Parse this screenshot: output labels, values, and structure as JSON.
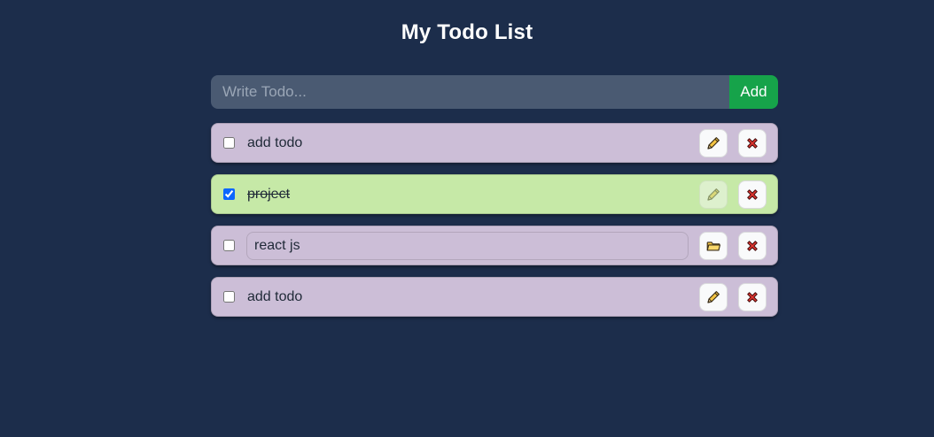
{
  "header": {
    "title": "My Todo List"
  },
  "add_form": {
    "placeholder": "Write Todo...",
    "value": "",
    "button_label": "Add"
  },
  "todos": [
    {
      "text": "add todo",
      "completed": false,
      "editing": false,
      "action_icon": "pencil-icon",
      "delete_icon": "close-icon"
    },
    {
      "text": "project",
      "completed": true,
      "editing": false,
      "action_icon": "pencil-icon",
      "delete_icon": "close-icon"
    },
    {
      "text": "react js",
      "completed": false,
      "editing": true,
      "action_icon": "folder-icon",
      "delete_icon": "close-icon"
    },
    {
      "text": "add todo",
      "completed": false,
      "editing": false,
      "action_icon": "pencil-icon",
      "delete_icon": "close-icon"
    }
  ],
  "colors": {
    "page_background": "#1c2d4b",
    "input_background": "#4a5a72",
    "add_button": "#16a34a",
    "todo_background": "#ccbed7",
    "todo_done_background": "#c6e9a7"
  }
}
